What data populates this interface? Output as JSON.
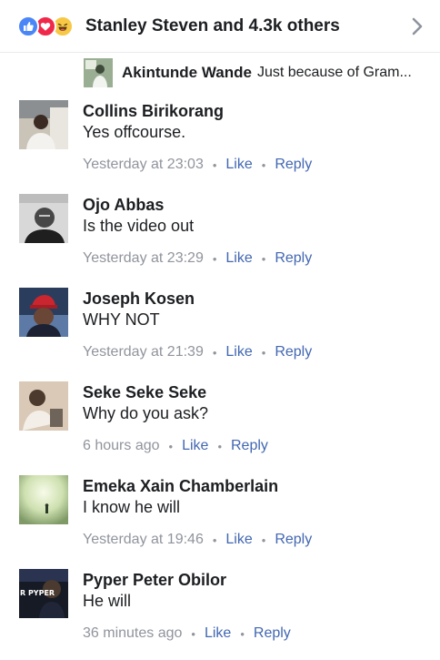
{
  "header": {
    "title": "Stanley Steven and 4.3k others",
    "reaction_icons": [
      "like-icon",
      "love-icon",
      "haha-icon"
    ],
    "chevron_icon": "chevron-right-icon"
  },
  "reply_preview": {
    "name": "Akintunde Wande",
    "text": "Just because of Gram..."
  },
  "comments": [
    {
      "name": "Collins Birikorang",
      "text": "Yes offcourse.",
      "time": "Yesterday at 23:03",
      "like": "Like",
      "reply": "Reply"
    },
    {
      "name": "Ojo Abbas",
      "text": "Is the video out",
      "time": "Yesterday at 23:29",
      "like": "Like",
      "reply": "Reply"
    },
    {
      "name": "Joseph Kosen",
      "text": "WHY NOT",
      "time": "Yesterday at 21:39",
      "like": "Like",
      "reply": "Reply"
    },
    {
      "name": "Seke Seke Seke",
      "text": "Why do you ask?",
      "time": "6 hours ago",
      "like": "Like",
      "reply": "Reply"
    },
    {
      "name": "Emeka Xain Chamberlain",
      "text": "I know he will",
      "time": "Yesterday at 19:46",
      "like": "Like",
      "reply": "Reply"
    },
    {
      "name": "Pyper Peter Obilor",
      "text": "He will",
      "time": "36 minutes ago",
      "like": "Like",
      "reply": "Reply"
    }
  ],
  "avatar_text": {
    "pyper": "R PYPER"
  },
  "colors": {
    "link": "#4267b2",
    "meta": "#90949c",
    "like_reaction": "#4a86f7",
    "love_reaction": "#f0284a",
    "haha_reaction": "#f7c845"
  }
}
